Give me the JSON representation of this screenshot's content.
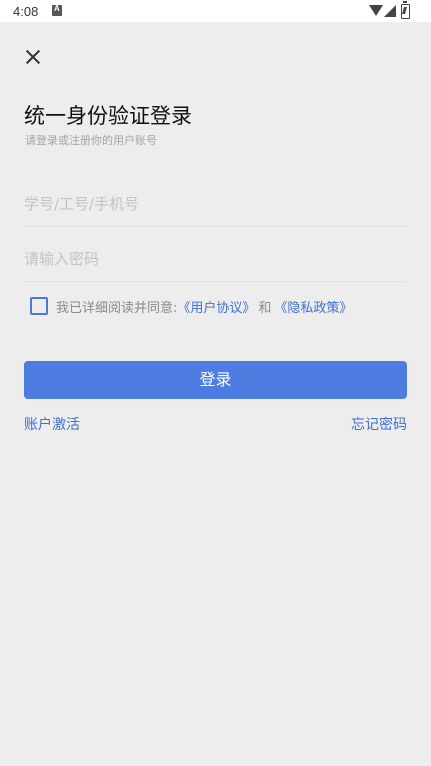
{
  "status_bar": {
    "time": "4:08"
  },
  "header": {
    "title": "统一身份验证登录",
    "subtitle": "请登录或注册你的用户账号"
  },
  "form": {
    "username_placeholder": "学号/工号/手机号",
    "username_value": "",
    "password_placeholder": "请输入密码",
    "password_value": ""
  },
  "agreement": {
    "checked": false,
    "prefix": "我已详细阅读并同意:",
    "user_agreement": "《用户协议》",
    "and": "和",
    "privacy_policy": "《隐私政策》"
  },
  "actions": {
    "login_label": "登录",
    "activate_label": "账户激活",
    "forgot_label": "忘记密码"
  },
  "colors": {
    "accent": "#4f7ce0",
    "link": "#3f6fd0",
    "background": "#ededed"
  },
  "icons": {
    "close": "close-icon",
    "wifi": "wifi-icon",
    "signal": "signal-icon",
    "battery": "battery-icon",
    "notification": "a-notification-icon"
  }
}
